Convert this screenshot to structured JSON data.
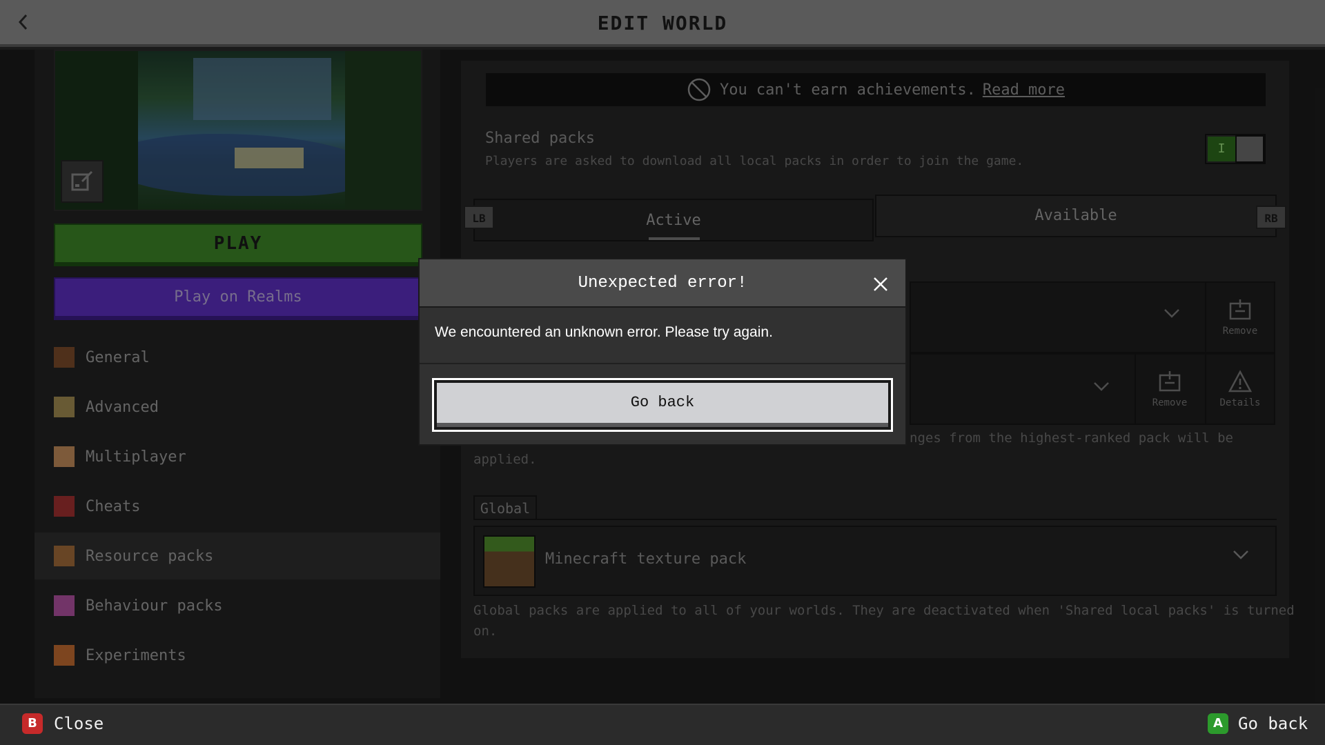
{
  "header": {
    "title": "EDIT WORLD",
    "back_icon": "chevron-left-icon"
  },
  "left": {
    "play_label": "PLAY",
    "realms_label": "Play on Realms",
    "nav": [
      {
        "label": "General",
        "icon": "general-icon",
        "color": "#7a4a2a"
      },
      {
        "label": "Advanced",
        "icon": "advanced-icon",
        "color": "#a08a50"
      },
      {
        "label": "Multiplayer",
        "icon": "multiplayer-icon",
        "color": "#c08a5a"
      },
      {
        "label": "Cheats",
        "icon": "cheats-icon",
        "color": "#a03030"
      },
      {
        "label": "Resource packs",
        "icon": "resource-packs-icon",
        "color": "#a06a3a",
        "active": true
      },
      {
        "label": "Behaviour packs",
        "icon": "behaviour-packs-icon",
        "color": "#b050a0"
      },
      {
        "label": "Experiments",
        "icon": "experiments-icon",
        "color": "#c06a30"
      }
    ]
  },
  "right": {
    "achievements_text": "You can't earn achievements.",
    "achievements_link": "Read more",
    "shared_title": "Shared packs",
    "shared_desc": "Players are asked to download all local packs in order to join the game.",
    "toggle_on_mark": "I",
    "tab_active": "Active",
    "tab_available": "Available",
    "lb": "LB",
    "rb": "RB",
    "remove_label": "Remove",
    "details_label": "Details",
    "resource_note_a": "nges from the highest-ranked pack will be",
    "resource_note_b": "applied.",
    "global_tab": "Global",
    "global_pack_name": "Minecraft texture pack",
    "global_note_1": "Global packs are applied to all of your worlds. They are deactivated when 'Shared local packs' is turned",
    "global_note_2": "on."
  },
  "modal": {
    "title": "Unexpected error!",
    "body": "We encountered an unknown error. Please try again.",
    "button_label": "Go back"
  },
  "footer": {
    "b_key": "B",
    "close_label": "Close",
    "a_key": "A",
    "goback_label": "Go back"
  }
}
